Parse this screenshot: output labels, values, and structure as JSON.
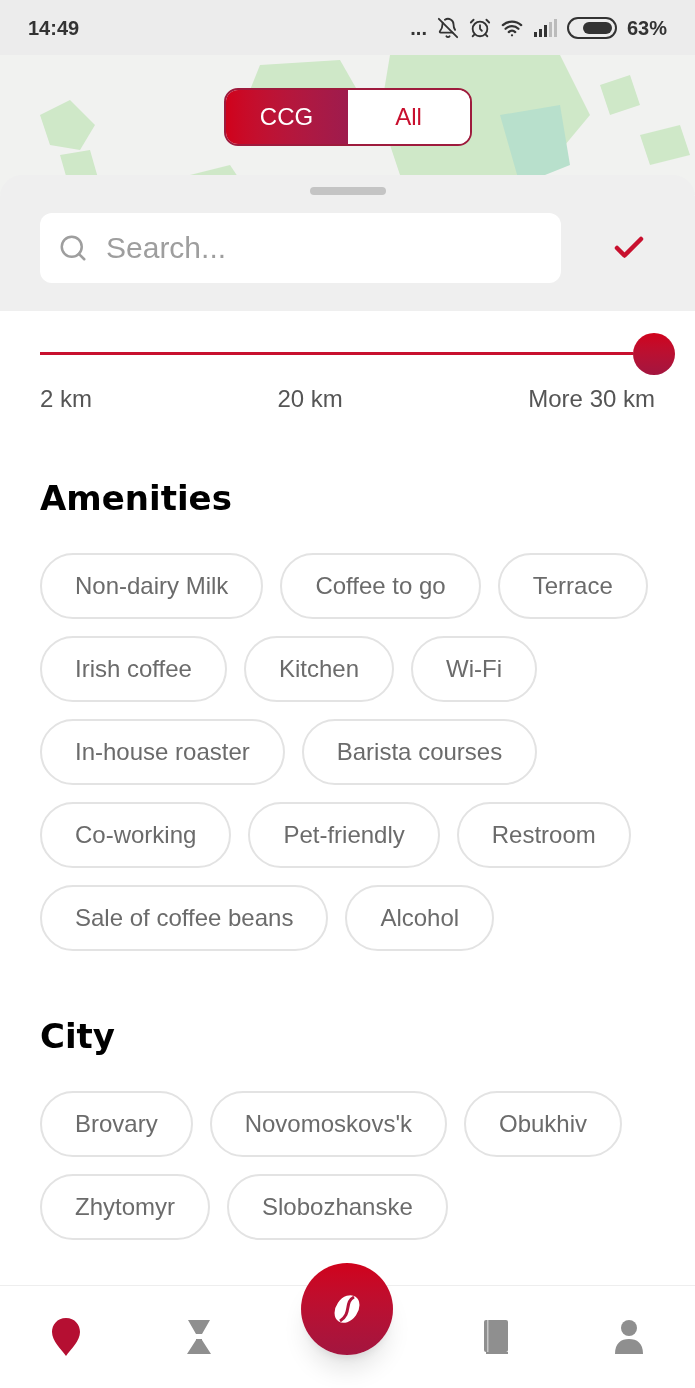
{
  "status_bar": {
    "time": "14:49",
    "dots": "...",
    "battery": "63%"
  },
  "source_toggle": [
    {
      "label": "CCG",
      "selected": true
    },
    {
      "label": "All",
      "selected": false
    }
  ],
  "search": {
    "placeholder": "Search..."
  },
  "distance": {
    "level": 1,
    "labels": [
      "2 km",
      "20 km",
      "More 30 km"
    ]
  },
  "sections": [
    {
      "title": "Amenities",
      "chips": [
        "Non-dairy Milk",
        "Coffee to go",
        "Terrace",
        "Irish coffee",
        "Kitchen",
        "Wi-Fi",
        "In-house roaster",
        "Barista courses",
        "Co-working",
        "Pet-friendly",
        "Restroom",
        "Sale of coffee beans",
        "Alcohol"
      ]
    },
    {
      "title": "City",
      "chips": [
        "Brovary",
        "Novomoskovs'k",
        "Obukhiv",
        "Zhytomyr",
        "Slobozhanske"
      ]
    }
  ],
  "nav": [
    {
      "kind": "map",
      "selected": true
    },
    {
      "kind": "brew",
      "selected": false
    },
    {
      "kind": "coffee",
      "selected": false
    },
    {
      "kind": "book",
      "selected": false
    },
    {
      "kind": "profile",
      "selected": false
    }
  ]
}
